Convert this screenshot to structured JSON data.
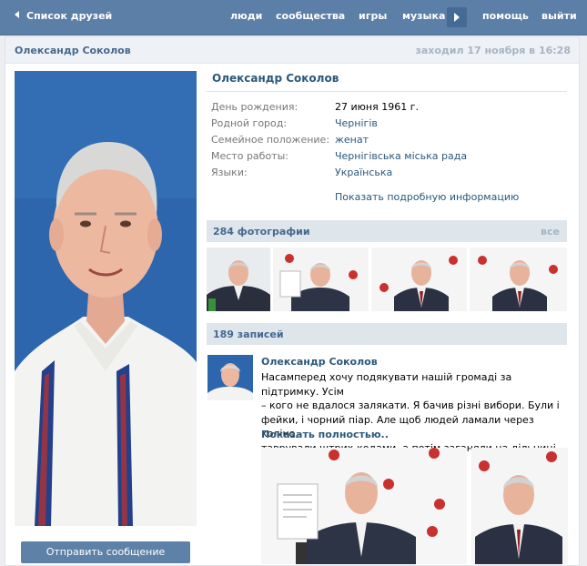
{
  "topbar": {
    "back_label": "Список друзей",
    "nav": [
      "люди",
      "сообщества",
      "игры",
      "музыка",
      "помощь",
      "выйти"
    ]
  },
  "header": {
    "name": "Олександр Соколов",
    "last_seen": "заходил 17 ноября в 16:28"
  },
  "profile": {
    "name": "Олександр Соколов",
    "rows": [
      {
        "label": "День рождения:",
        "value": "27 июня 1961 г."
      },
      {
        "label": "Родной город:",
        "value": "Чернігів"
      },
      {
        "label": "Семейное положение:",
        "value": "женат"
      },
      {
        "label": "Место работы:",
        "value": "Чернігівська міська рада"
      },
      {
        "label": "Языки:",
        "value": "Українська"
      }
    ],
    "more_info": "Показать подробную информацию"
  },
  "photos": {
    "title": "284 фотографии",
    "all_label": "все"
  },
  "wall": {
    "title": "189 записей",
    "post": {
      "author": "Олександр Соколов",
      "lines": [
        "Насамперед хочу подякувати нашій громаді за підтримку. Усім",
        "– кого не вдалося залякати. Я бачив різні вибори. Були і",
        "фейки, і чорний піар. Але щоб людей ламали через коліно,",
        "таврували штрих-кодами, а потім заганяли на дільниці..."
      ],
      "more_label": "Показать полностью.."
    }
  },
  "actions": {
    "send_message": "Отправить сообщение"
  },
  "colors": {
    "topbar": "#5b7fa6",
    "link": "#2b587a",
    "section_bar": "#dee5eb",
    "photo_bg": "#2d66ad"
  }
}
